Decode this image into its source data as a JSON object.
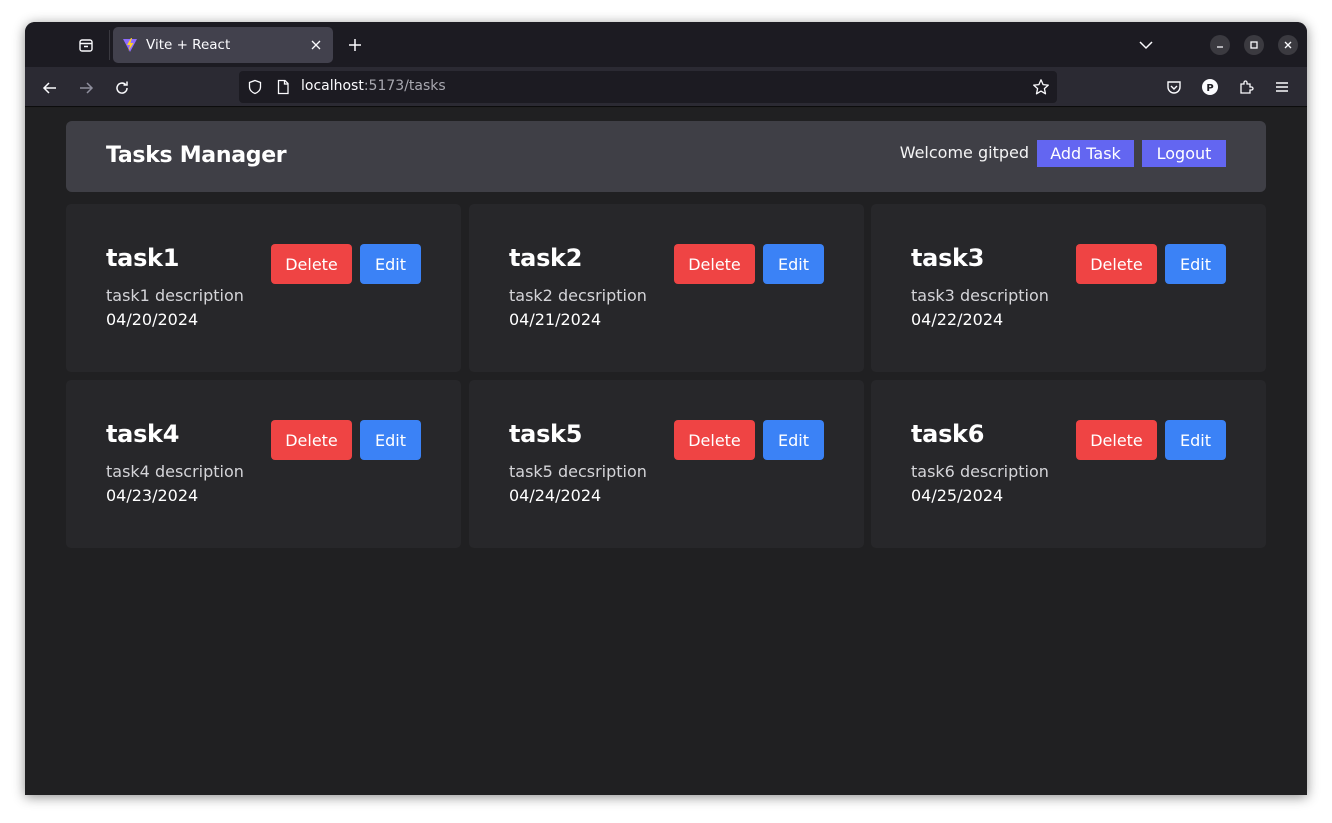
{
  "browser": {
    "tab": {
      "title": "Vite + React",
      "favicon": "vite-logo-icon"
    },
    "url": {
      "host": "localhost",
      "rest": ":5173/tasks"
    },
    "icons": [
      "tab-list-icon",
      "close-icon",
      "plus-icon",
      "chevron-down-icon",
      "minimize-icon",
      "maximize-icon",
      "back-icon",
      "forward-icon",
      "reload-icon",
      "shield-icon",
      "page-icon",
      "star-icon",
      "pocket-icon",
      "profile-icon",
      "extensions-icon",
      "menu-icon"
    ],
    "profile_initial": "P"
  },
  "header": {
    "title": "Tasks Manager",
    "welcome": "Welcome gitped",
    "add_task_label": "Add Task",
    "logout_label": "Logout"
  },
  "tasks": [
    {
      "title": "task1",
      "description": "task1 description",
      "date": "04/20/2024",
      "delete_label": "Delete",
      "edit_label": "Edit"
    },
    {
      "title": "task2",
      "description": "task2 decsription",
      "date": "04/21/2024",
      "delete_label": "Delete",
      "edit_label": "Edit"
    },
    {
      "title": "task3",
      "description": "task3 description",
      "date": "04/22/2024",
      "delete_label": "Delete",
      "edit_label": "Edit"
    },
    {
      "title": "task4",
      "description": "task4 description",
      "date": "04/23/2024",
      "delete_label": "Delete",
      "edit_label": "Edit"
    },
    {
      "title": "task5",
      "description": "task5 decsription",
      "date": "04/24/2024",
      "delete_label": "Delete",
      "edit_label": "Edit"
    },
    {
      "title": "task6",
      "description": "task6 description",
      "date": "04/25/2024",
      "delete_label": "Delete",
      "edit_label": "Edit"
    }
  ],
  "colors": {
    "accent": "#6366f1",
    "delete": "#ef4444",
    "edit": "#3b82f6",
    "card": "#27272a",
    "header": "#3f3f46",
    "background": "#202022"
  }
}
